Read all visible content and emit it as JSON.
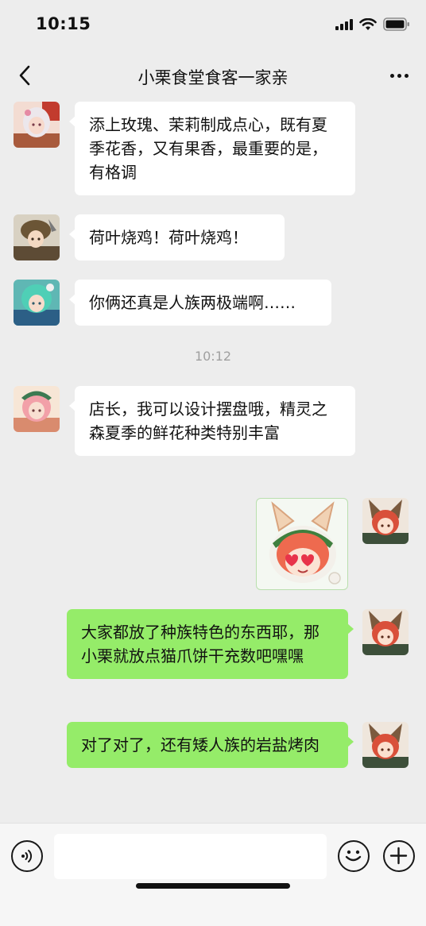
{
  "status_bar": {
    "time": "10:15"
  },
  "nav": {
    "title": "小栗食堂食客一家亲"
  },
  "messages": [
    {
      "side": "in",
      "text": "添上玫瑰、茉莉制成点心，既有夏季花香，又有果香，最重要的是，有格调"
    },
    {
      "side": "in",
      "text": "荷叶烧鸡！荷叶烧鸡！"
    },
    {
      "side": "in",
      "text": "你俩还真是人族两极端啊……"
    },
    {
      "side": "in",
      "text": "店长，我可以设计摆盘哦，精灵之森夏季的鲜花种类特别丰富"
    },
    {
      "side": "out",
      "text": "大家都放了种族特色的东西耶，那小栗就放点猫爪饼干充数吧嘿嘿"
    },
    {
      "side": "out",
      "text": "对了对了，还有矮人族的岩盐烤肉"
    }
  ],
  "time_divider": "10:12",
  "icons": {
    "back": "chevron-left-icon",
    "more": "ellipsis-icon",
    "voice": "voice-icon",
    "emoji": "smiley-icon",
    "plus": "plus-icon",
    "sticker": "heart-eyes-fox-girl-sticker"
  },
  "colors": {
    "background": "#ededed",
    "incoming_bubble": "#ffffff",
    "outgoing_bubble": "#95ec69",
    "text": "#111111",
    "time_divider": "#a0a0a0",
    "input_bar": "#f6f6f6"
  }
}
